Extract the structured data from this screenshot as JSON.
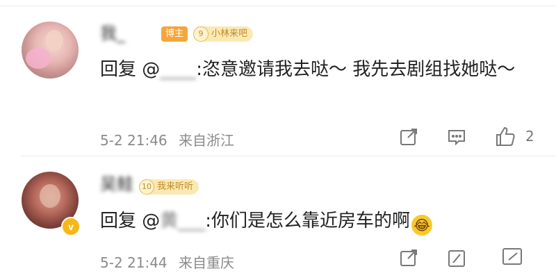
{
  "comments": [
    {
      "username": "我_",
      "role_badge": "博主",
      "fan_badge": {
        "level": "9",
        "label": "小林来吧"
      },
      "reply_prefix": "回复 @",
      "reply_target": "____",
      "text": ":恣意邀请我去哒～ 我先去剧组找她哒～",
      "date": "5-2 21:46",
      "location": "来自浙江",
      "like_count": "2"
    },
    {
      "username": "吴鲑",
      "fan_badge": {
        "level": "10",
        "label": "我来听听"
      },
      "verified_mark": "v",
      "reply_prefix": "回复 @",
      "reply_target": "黄___",
      "text": ":你们是怎么靠近房车的啊",
      "emoji": "😂",
      "date": "5-2 21:44",
      "location": "来自重庆"
    }
  ],
  "icons": [
    "share-icon",
    "comment-icon",
    "like-icon"
  ],
  "colors": {
    "role_badge": "#f4a63a",
    "fan_badge_bg": "#fbe9b4",
    "meta_text": "#8a8a8a",
    "verified": "#f7b718"
  }
}
